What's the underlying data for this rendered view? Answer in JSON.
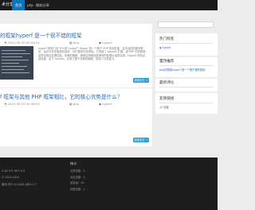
{
  "nav": {
    "brand": "术分享",
    "items": [
      {
        "label": "首页",
        "active": true
      },
      {
        "label": "php",
        "active": false
      },
      {
        "label": "微软分享",
        "active": false
      }
    ]
  },
  "posts": [
    {
      "title": "的框架hyperf 是一个很不错的框架",
      "date": "2024-09-30 00:59:31",
      "category": "php",
      "tag": "hyperf",
      "excerpt": "Hyperf 框架介绍 什么是 Hyperf？Hyperf 是一个基于 PHP 的高性能、高灵活性的服务框架，旨在为开发者提供高效、可扩展的开发体验。它采用了 Swoole 扩展，用 PHP 的协程提高项目响应处理性能。协程的微服、使得应用程序能够同时处理大量的请求。Hyperf 的特点 高性能：由于 Swoole，实现了基于协程的编程，提高了并发能力。",
      "read_more": "阅读全文 →"
    },
    {
      "title": "f 框架与其他 PHP 框架相比，它的核心优势是什么？",
      "date": "2024-09-29 00:48:35",
      "category": "php",
      "tag": "hyperf",
      "read_more": "阅读全文 →"
    }
  ],
  "sidebar": {
    "hot_title": "热门标签",
    "hot_tag": "hyperf",
    "recommend_title": "置顶推荐",
    "recommend_item": "php的框架hyperf 是一个很不错的框架",
    "comments_title": "最新评论",
    "friends_title": "友情链接",
    "friends_item": "百度"
  },
  "footer": {
    "left_lines": [
      "0.18. 9个 WIT: 4.0",
      "© 2014-2024",
      "微信2件3 24-0001 8年4-2 7"
    ],
    "stats_title": "统计",
    "stats": [
      "文章总数：2",
      "评论总数：0",
      "浏览量：39",
      "标签总数：1"
    ]
  },
  "colors": {
    "nav_bg": "#1b1b1b",
    "nav_active": "#0a75b8",
    "link": "#2b6bb5",
    "button": "#2a9fd6",
    "footer_bg": "#1d1d1d"
  }
}
